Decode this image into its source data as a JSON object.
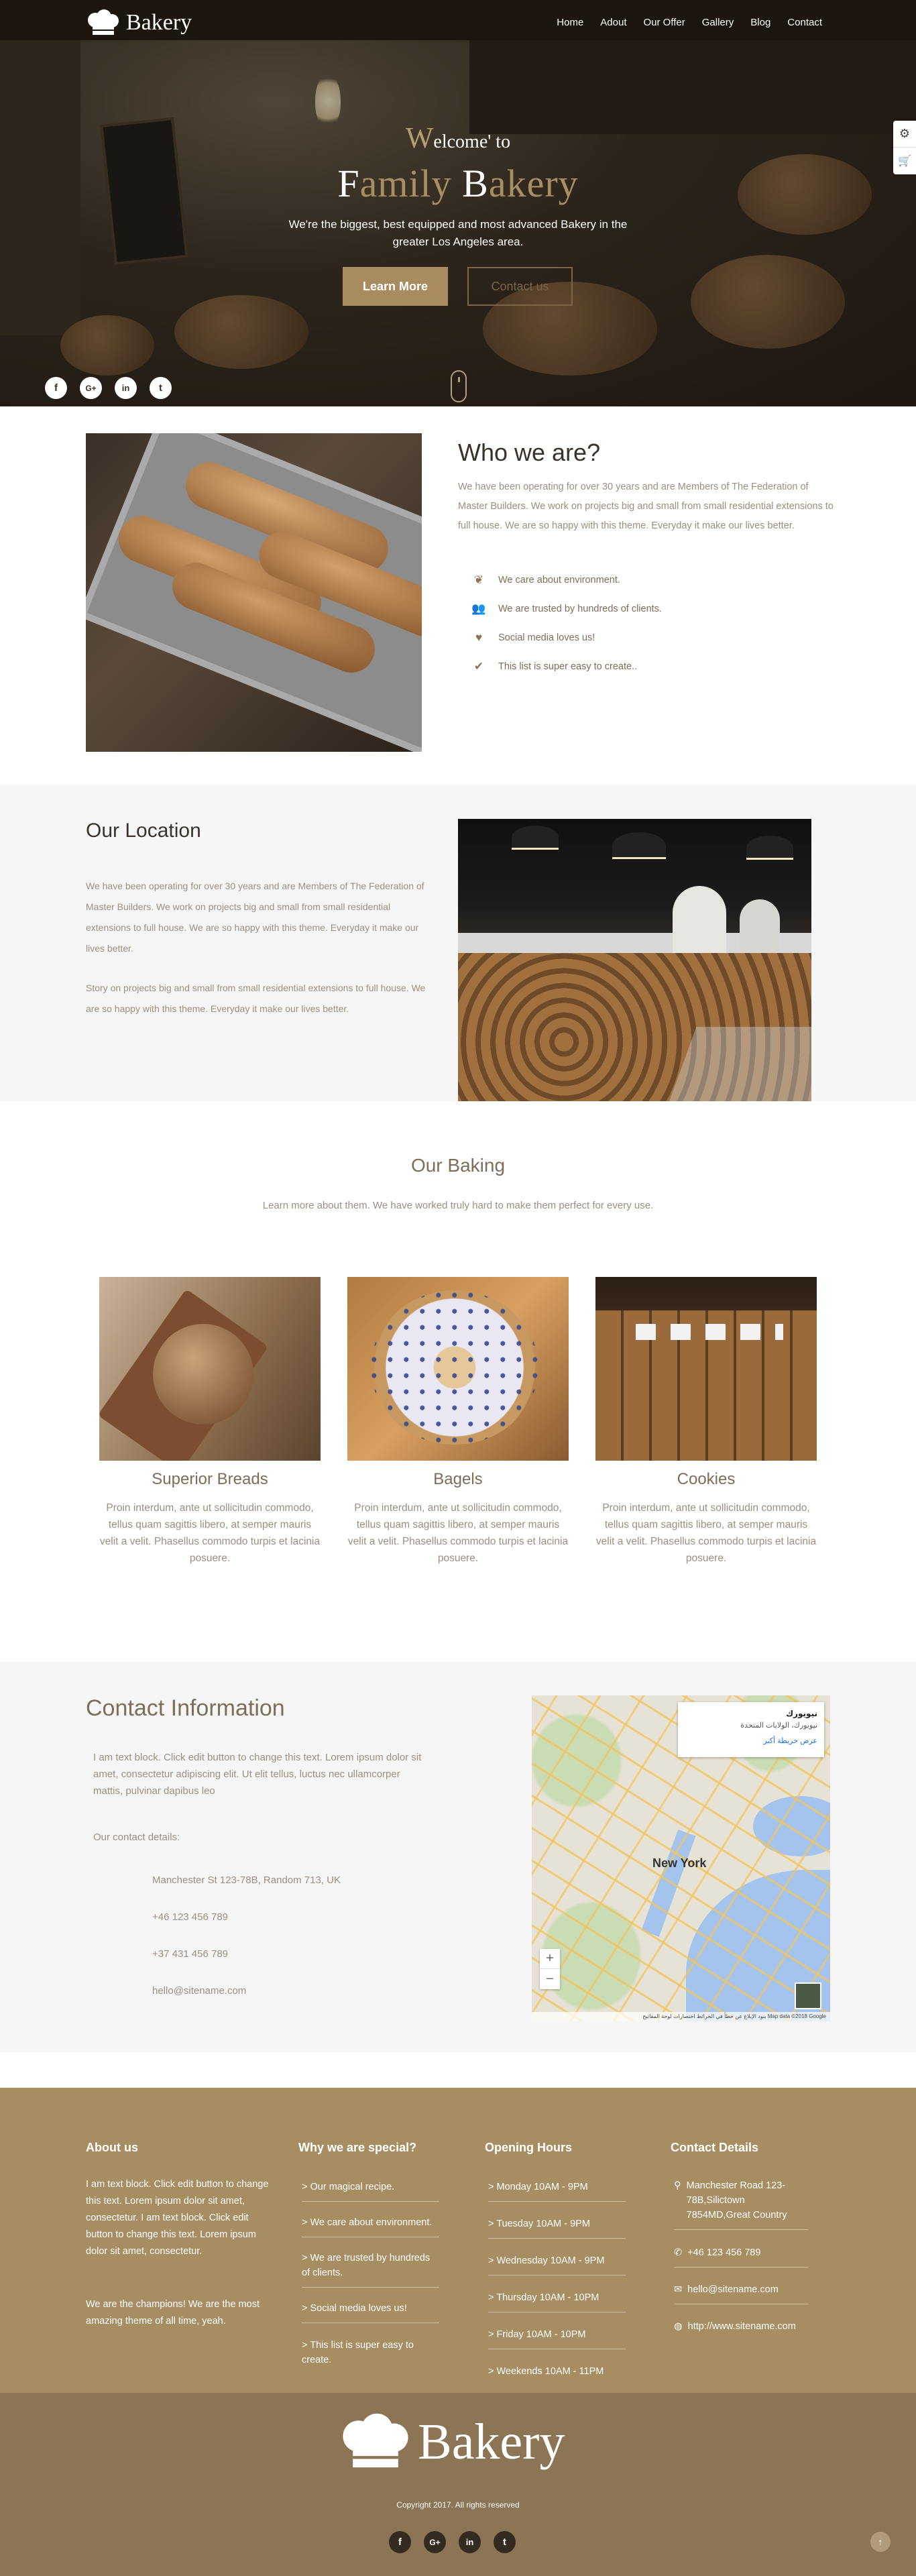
{
  "brand": {
    "name": "Bakery"
  },
  "nav": {
    "items": [
      "Home",
      "Adout",
      "Our Offer",
      "Gallery",
      "Blog",
      "Contact"
    ]
  },
  "hero": {
    "line1_first": "W",
    "line1_rest": "elcome' to",
    "line2_f": "F",
    "line2_amily": "amily ",
    "line2_b": "B",
    "line2_akery": "akery",
    "subtitle": "We're the biggest, best equipped and most advanced Bakery in the greater Los Angeles area.",
    "learn_btn": "Learn More",
    "contact_btn": "Contact us",
    "social": [
      "f",
      "G+",
      "in",
      "t"
    ]
  },
  "who": {
    "title": "Who we are?",
    "text": "We have been operating for over 30 years and are Members of The Federation of Master Builders. We work on projects big and small from small residential extensions to full house. We are so happy with this theme. Everyday it make our lives better.",
    "items": [
      "We care about environment.",
      "We are trusted by hundreds of clients.",
      "Social media loves us!",
      "This list is super easy to create.."
    ]
  },
  "location": {
    "title": "Our Location",
    "p1": "We have been operating for over 30 years and are Members of The Federation of Master Builders. We work on projects big and small from small residential extensions to full house. We are so happy with this theme. Everyday it make our lives better.",
    "p2": "Story on projects big and small from small residential extensions to full house. We are so happy with this theme. Everyday it make our lives better."
  },
  "baking": {
    "title": "Our Baking",
    "subtitle": "Learn more about them. We have worked truly hard to make them perfect for every use.",
    "cards": [
      {
        "title": "Superior Breads",
        "text": "Proin interdum, ante ut sollicitudin commodo, tellus quam sagittis libero, at semper mauris velit a velit. Phasellus commodo turpis et lacinia posuere."
      },
      {
        "title": "Bagels",
        "text": "Proin interdum, ante ut sollicitudin commodo, tellus quam sagittis libero, at semper mauris velit a velit. Phasellus commodo turpis et lacinia posuere."
      },
      {
        "title": "Cookies",
        "text": "Proin interdum, ante ut sollicitudin commodo, tellus quam sagittis libero, at semper mauris velit a velit. Phasellus commodo turpis et lacinia posuere."
      }
    ]
  },
  "contact": {
    "title": "Contact Information",
    "text": "I am text block. Click edit button to change this text. Lorem ipsum dolor sit amet, consectetur adipiscing elit. Ut elit tellus, luctus nec ullamcorper mattis, pulvinar dapibus leo",
    "details_label": "Our contact details:",
    "details": [
      "Manchester St 123-78B, Random 713, UK",
      "+46 123 456 789",
      "+37 431 456 789",
      "hello@sitename.com"
    ]
  },
  "map": {
    "city": "New York",
    "popup_title": "نيويورك",
    "popup_line": "نيويورك، الولايات المتحدة",
    "popup_link": "عرض خريطة أكبر",
    "zoom_in": "+",
    "zoom_out": "−",
    "attribution": "Map data ©2018 Google   بنود   الإبلاغ عن خطأ في الخرائط   اختصارات لوحة المفاتيح"
  },
  "footer": {
    "about_title": "About us",
    "about_p1": "I am text block. Click edit button to change this text. Lorem ipsum dolor sit amet, consectetur. I am text block. Click edit button to change this text. Lorem ipsum dolor sit amet, consectetur.",
    "about_p2": "We are the champions! We are the most amazing theme of all time, yeah.",
    "special_title": "Why we are special?",
    "special": [
      "> Our magical recipe.",
      "> We care about environment.",
      "> We are trusted by hundreds of clients.",
      "> Social media loves us!",
      "> This list is super easy to create."
    ],
    "hours_title": "Opening Hours",
    "hours": [
      "> Monday 10AM - 9PM",
      "> Tuesday 10AM - 9PM",
      "> Wednesday 10AM - 9PM",
      "> Thursday 10AM - 10PM",
      "> Friday 10AM - 10PM",
      "> Weekends 10AM - 11PM"
    ],
    "details_title": "Contact Details",
    "address": "Manchester Road 123-78B,Silictown 7854MD,Great Country",
    "phone": "+46 123 456 789",
    "email": "hello@sitename.com",
    "web": "http://www.sitename.com",
    "brand": "Bakery",
    "copyright": "Copyright 2017. All rights reserved",
    "social": [
      "f",
      "G+",
      "in",
      "t"
    ]
  },
  "colors": {
    "accent": "#a78d62",
    "footer_bottom": "#8b7554",
    "text": "#9a8f80"
  }
}
